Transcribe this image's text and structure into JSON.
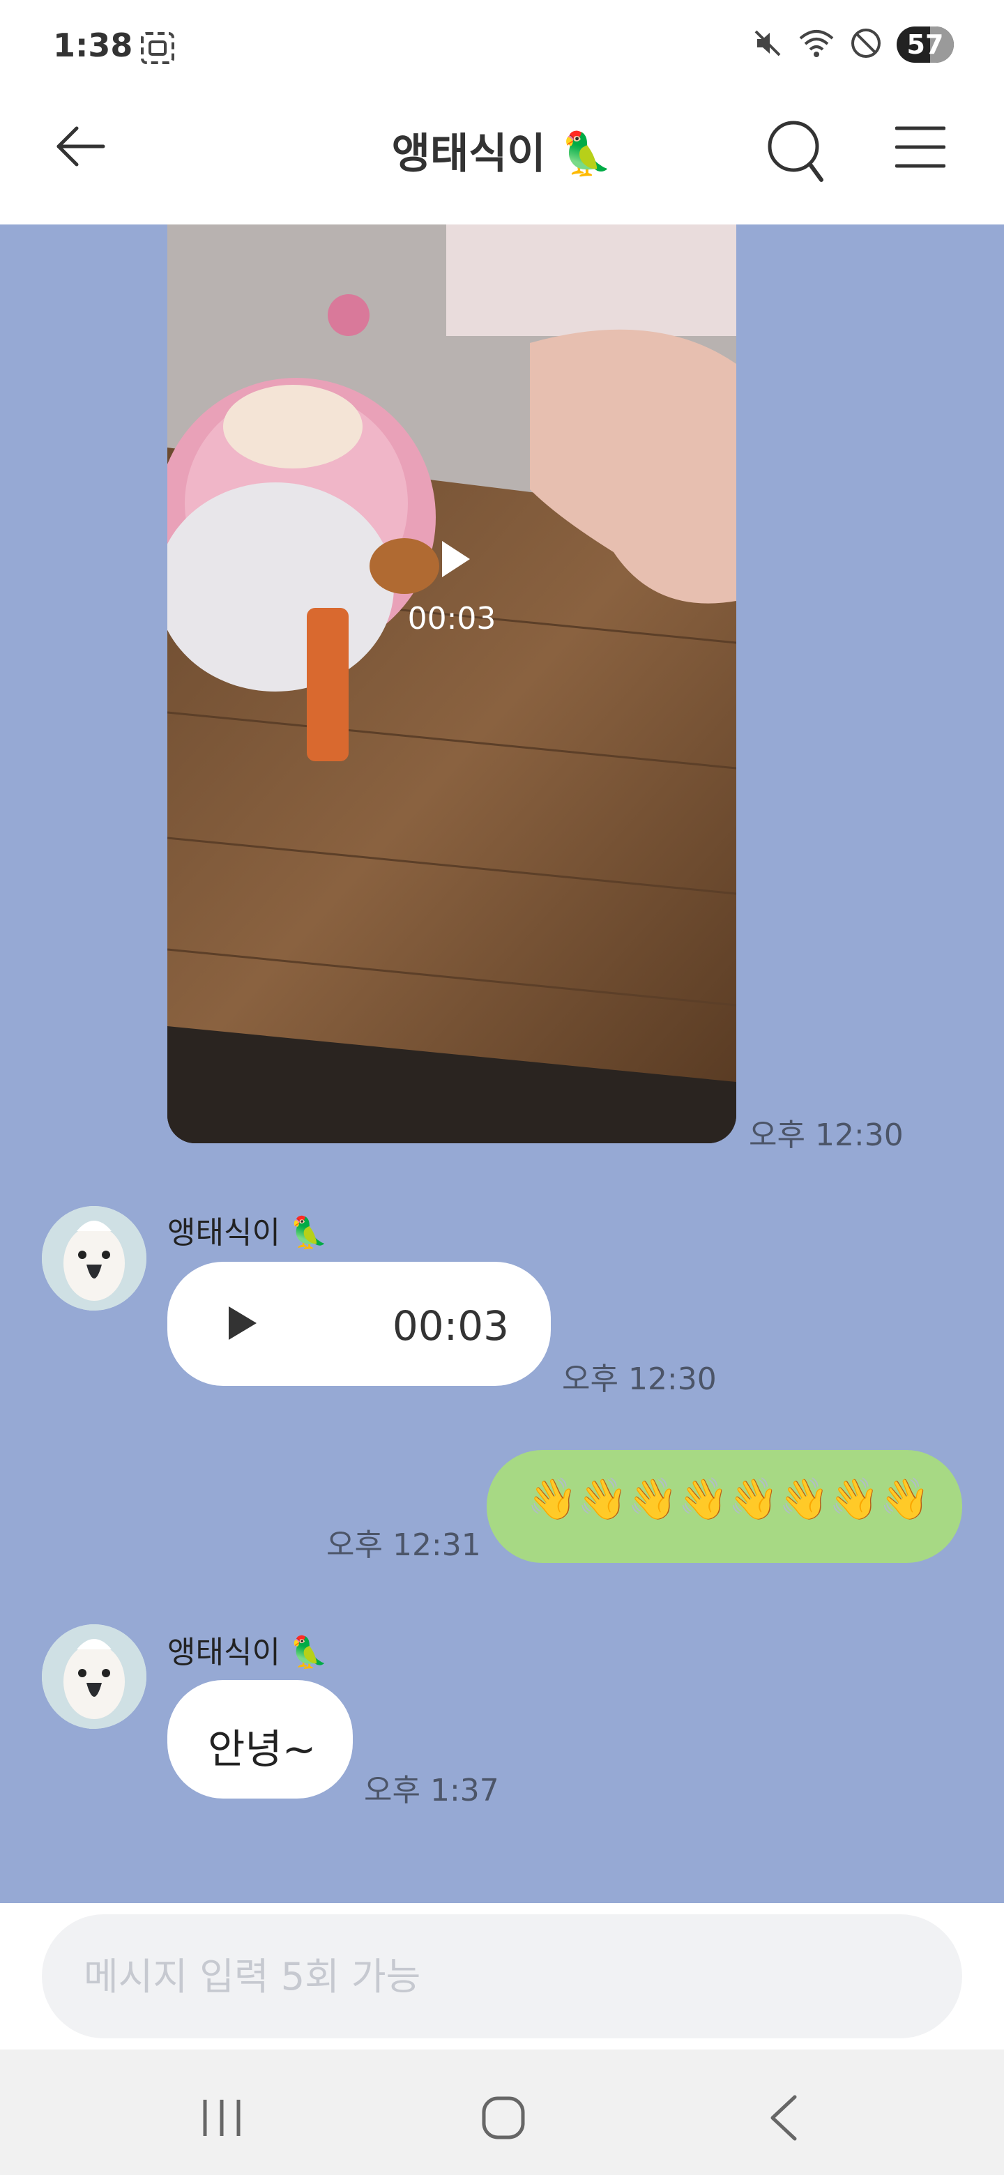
{
  "status_bar": {
    "time": "1:38",
    "battery": "57",
    "icons": [
      "screenshot-icon",
      "mute-icon",
      "wifi-icon",
      "do-not-disturb-icon"
    ]
  },
  "header": {
    "title": "앵태식이 🦜",
    "back_icon": "back-arrow-icon",
    "search_icon": "search-icon",
    "menu_icon": "menu-icon"
  },
  "messages": [
    {
      "type": "video",
      "direction": "received",
      "duration": "00:03",
      "time": "오후 12:30"
    },
    {
      "type": "audio",
      "direction": "received",
      "sender": "앵태식이 🦜",
      "duration": "00:03",
      "time": "오후 12:30"
    },
    {
      "type": "emoji",
      "direction": "sent",
      "text": "👋👋👋👋👋👋👋👋",
      "time": "오후 12:31"
    },
    {
      "type": "text",
      "direction": "received",
      "sender": "앵태식이 🦜",
      "text": "안녕~",
      "time": "오후 1:37"
    }
  ],
  "input": {
    "placeholder": "메시지 입력 5회 가능"
  },
  "colors": {
    "chat_background": "#96a9d4",
    "sent_bubble": "#a7d984",
    "received_bubble": "#ffffff"
  }
}
